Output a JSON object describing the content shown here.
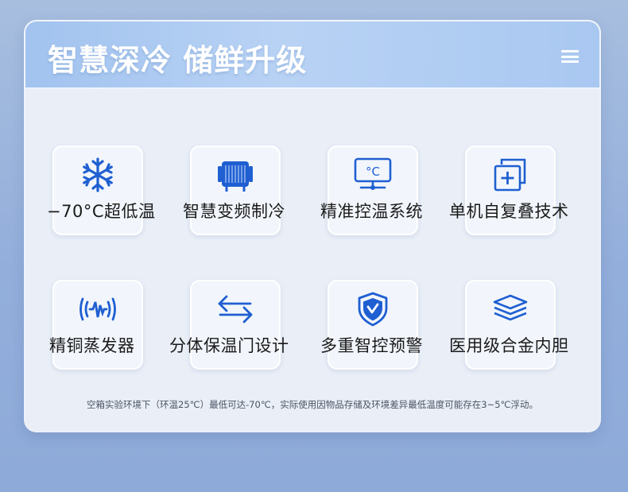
{
  "header": {
    "title": "智慧深冷 储鲜升级",
    "menu_icon": "hamburger-menu-icon"
  },
  "features": [
    {
      "label": "−70°C超低温",
      "icon": "snowflake-icon"
    },
    {
      "label": "智慧变频制冷",
      "icon": "compressor-icon"
    },
    {
      "label": "精准控温系统",
      "icon": "thermostat-display-icon"
    },
    {
      "label": "单机自复叠技术",
      "icon": "cascade-plus-icon"
    },
    {
      "label": "精铜蒸发器",
      "icon": "waveform-icon"
    },
    {
      "label": "分体保温门设计",
      "icon": "double-arrow-icon"
    },
    {
      "label": "多重智控预警",
      "icon": "shield-check-icon"
    },
    {
      "label": "医用级合金内胆",
      "icon": "layers-icon"
    }
  ],
  "icon_display_text": {
    "celsius": "°C"
  },
  "footnote": "空箱实验环境下（环温25℃）最低可达-70℃，实际使用因物品存储及环境差异最低温度可能存在3~5℃浮动。",
  "colors": {
    "accent": "#1f5fd1",
    "header_bg": "#a9c8f1",
    "page_bg": "#93aedb"
  }
}
